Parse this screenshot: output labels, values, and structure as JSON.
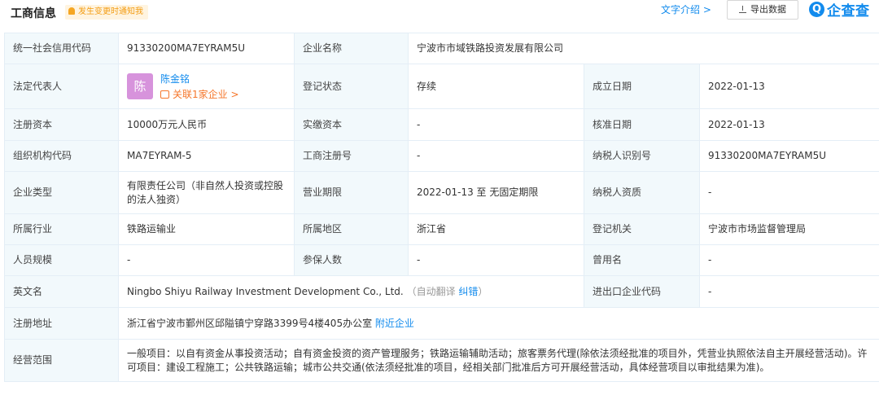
{
  "header": {
    "title": "工商信息",
    "notify_label": "发生变更时通知我",
    "text_intro_label": "文字介绍 >",
    "export_label": "导出数据",
    "logo_mark": "Q",
    "logo_text": "企查查"
  },
  "fields": {
    "credit_code_label": "统一社会信用代码",
    "credit_code": "91330200MA7EYRAM5U",
    "company_name_label": "企业名称",
    "company_name": "宁波市市域铁路投资发展有限公司",
    "legal_rep_label": "法定代表人",
    "legal_rep_avatar": "陈",
    "legal_rep_name": "陈金铭",
    "legal_rep_assoc": "关联1家企业 >",
    "reg_status_label": "登记状态",
    "reg_status": "存续",
    "founded_label": "成立日期",
    "founded": "2022-01-13",
    "reg_capital_label": "注册资本",
    "reg_capital": "10000万元人民币",
    "paid_capital_label": "实缴资本",
    "paid_capital": "-",
    "approval_date_label": "核准日期",
    "approval_date": "2022-01-13",
    "org_code_label": "组织机构代码",
    "org_code": "MA7EYRAM-5",
    "reg_no_label": "工商注册号",
    "reg_no": "-",
    "taxpayer_id_label": "纳税人识别号",
    "taxpayer_id": "91330200MA7EYRAM5U",
    "company_type_label": "企业类型",
    "company_type": "有限责任公司（非自然人投资或控股的法人独资）",
    "biz_term_label": "营业期限",
    "biz_term": "2022-01-13 至 无固定期限",
    "taxpayer_qual_label": "纳税人资质",
    "taxpayer_qual": "-",
    "industry_label": "所属行业",
    "industry": "铁路运输业",
    "region_label": "所属地区",
    "region": "浙江省",
    "reg_authority_label": "登记机关",
    "reg_authority": "宁波市市场监督管理局",
    "staff_size_label": "人员规模",
    "staff_size": "-",
    "insured_label": "参保人数",
    "insured": "-",
    "former_name_label": "曾用名",
    "former_name": "-",
    "english_name_label": "英文名",
    "english_name": "Ningbo Shiyu Railway Investment Development Co., Ltd.",
    "auto_translate_label": "（自动翻译",
    "correct_label": "纠错",
    "auto_translate_close": "）",
    "ie_code_label": "进出口企业代码",
    "ie_code": "-",
    "reg_address_label": "注册地址",
    "reg_address": "浙江省宁波市鄞州区邱隘镇宁穿路3399号4楼405办公室",
    "nearby_label": "附近企业",
    "biz_scope_label": "经营范围",
    "biz_scope": "一般项目：以自有资金从事投资活动；自有资金投资的资产管理服务；铁路运输辅助活动；旅客票务代理(除依法须经批准的项目外，凭营业执照依法自主开展经营活动)。许可项目：建设工程施工；公共铁路运输；城市公共交通(依法须经批准的项目，经相关部门批准后方可开展经营活动，具体经营项目以审批结果为准)。"
  }
}
